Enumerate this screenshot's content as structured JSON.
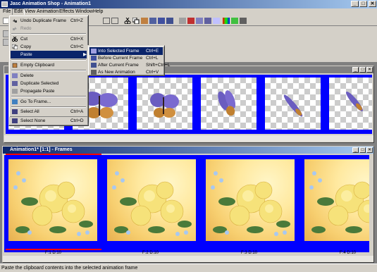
{
  "window": {
    "title": "Jasc Animation Shop - Animation1",
    "minimize": "_",
    "maximize": "□",
    "close": "✕"
  },
  "menubar": {
    "file": "File",
    "edit": "Edit",
    "view": "View",
    "animation": "Animation",
    "effects": "Effects",
    "window": "Window",
    "help": "Help"
  },
  "edit_menu": {
    "items": [
      {
        "label": "Undo Duplicate Frame",
        "shortcut": "Ctrl+Z",
        "icon": "undo-icon"
      },
      {
        "label": "Redo",
        "shortcut": "",
        "icon": "redo-icon",
        "disabled": true
      },
      {
        "label": "Cut",
        "shortcut": "Ctrl+X",
        "icon": "scissors-icon"
      },
      {
        "label": "Copy",
        "shortcut": "Ctrl+C",
        "icon": "copy-icon"
      },
      {
        "label": "Paste",
        "shortcut": "▶",
        "icon": "",
        "highlighted": true
      },
      {
        "label": "Empty Clipboard",
        "shortcut": "",
        "icon": "clipboard-icon"
      },
      {
        "label": "Delete",
        "shortcut": "",
        "icon": "delete-icon"
      },
      {
        "label": "Duplicate Selected",
        "shortcut": "",
        "icon": "duplicate-icon"
      },
      {
        "label": "Propagate Paste",
        "shortcut": "",
        "icon": "propagate-icon"
      },
      {
        "label": "Go To Frame...",
        "shortcut": "",
        "icon": "goto-frame-icon"
      },
      {
        "label": "Select All",
        "shortcut": "Ctrl+A",
        "icon": "select-all-icon"
      },
      {
        "label": "Select None",
        "shortcut": "Ctrl+D",
        "icon": "select-none-icon"
      }
    ]
  },
  "paste_submenu": {
    "items": [
      {
        "label": "Into Selected Frame",
        "shortcut": "Ctrl+E",
        "highlighted": true
      },
      {
        "label": "Before Current Frame",
        "shortcut": "Ctrl+L"
      },
      {
        "label": "After Current Frame",
        "shortcut": "Shift+Ctrl+L"
      },
      {
        "label": "As New Animation",
        "shortcut": "Ctrl+V"
      }
    ]
  },
  "animation_window": {
    "title": "Animation1* [1:1] - Frames",
    "frames": [
      {
        "label": "F:1  D:10"
      },
      {
        "label": "F:2  D:10"
      },
      {
        "label": "F:3  D:10"
      },
      {
        "label": "F:4  D:10"
      }
    ]
  },
  "butterfly_window": {
    "frame_count": 6
  },
  "statusbar": {
    "text": "Paste the clipboard contents into the selected animation frame"
  },
  "colors": {
    "selection_blue": "#0000ff",
    "highlight": "#0a246a",
    "chrome": "#d4d0c8",
    "rose": "#f5e070",
    "leaf": "#4a7a3a"
  }
}
